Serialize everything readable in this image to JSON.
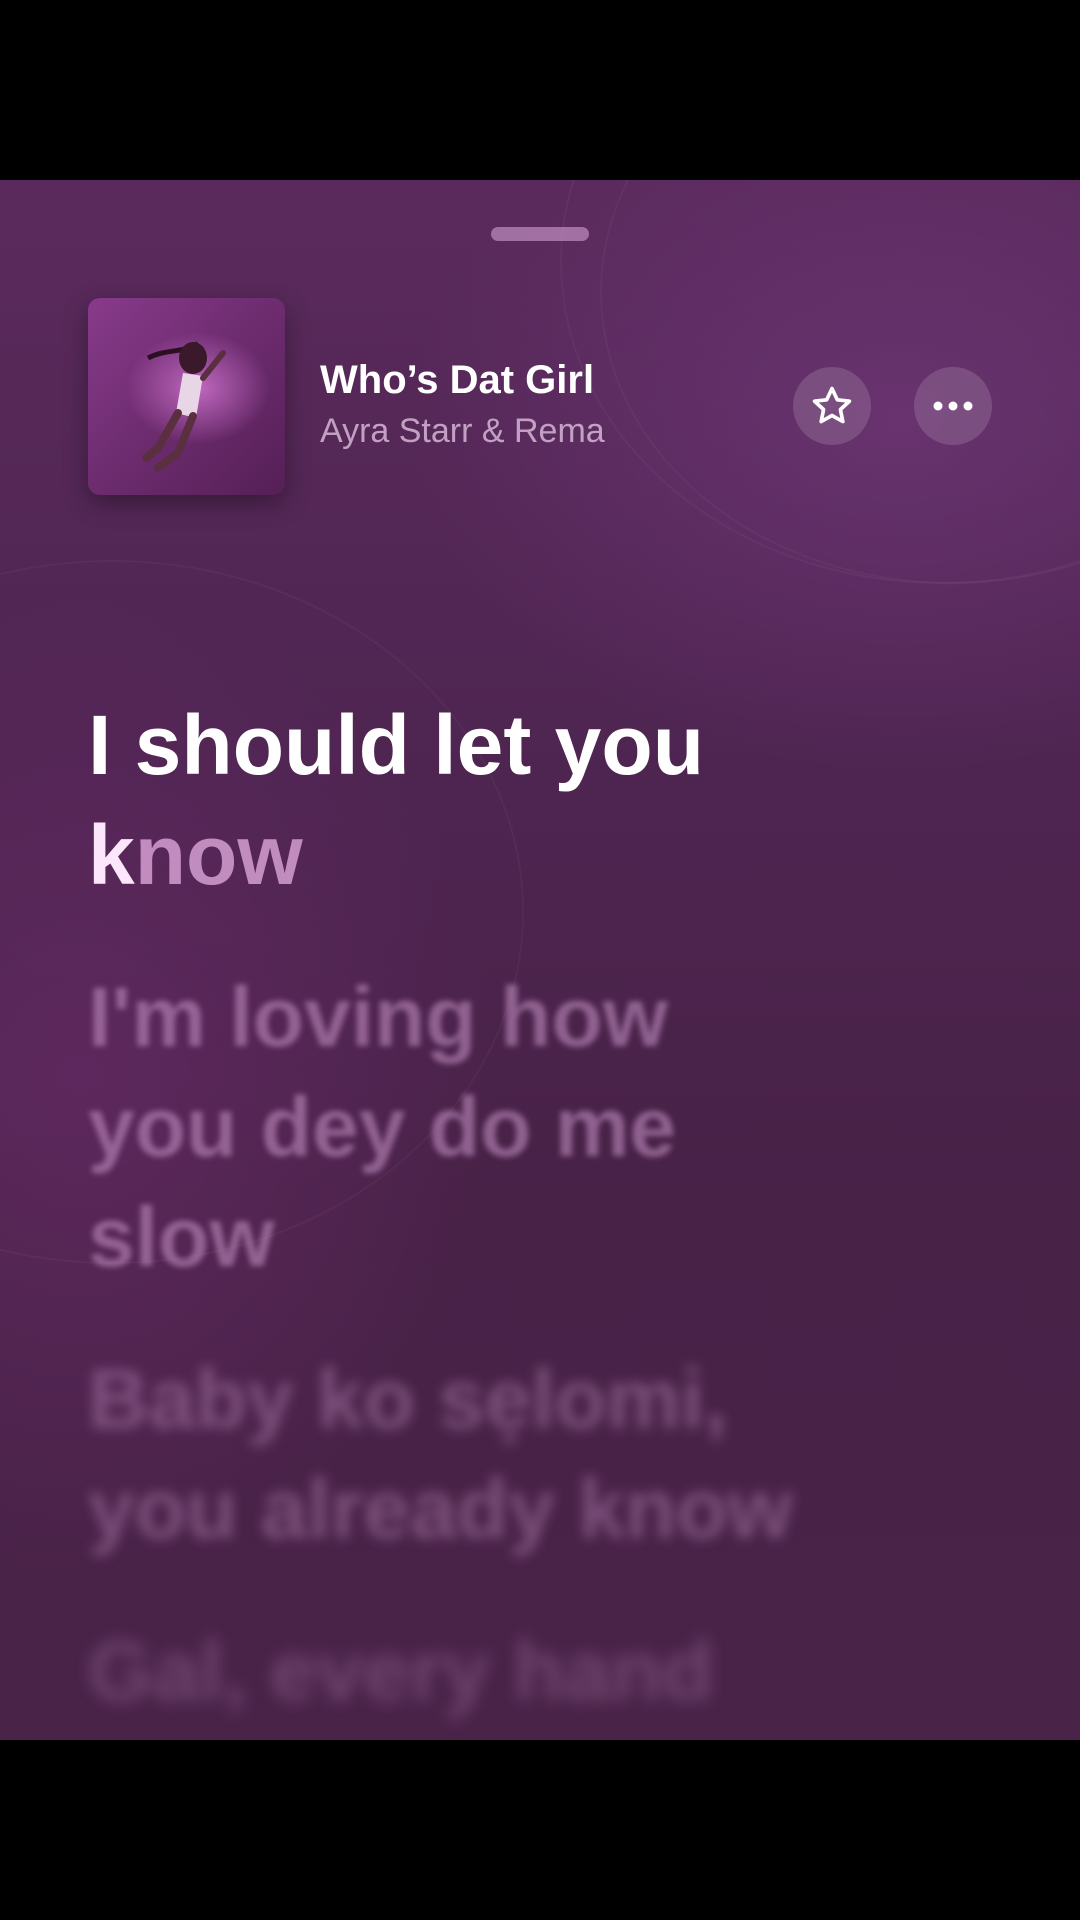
{
  "now_playing": {
    "title": "Who’s Dat Girl",
    "artist": "Ayra Starr & Rema"
  },
  "buttons": {
    "favorite_icon": "star-icon",
    "more_icon": "ellipsis-icon"
  },
  "lyrics": {
    "active_line": {
      "sung": "I should let you",
      "current_word_sung": "k",
      "current_word_pending": "now"
    },
    "upcoming": [
      "I'm loving how you dey do me slow",
      "Baby ko sẹlomi, you already know",
      "Gal, every hand"
    ]
  },
  "colors": {
    "background": "#4f2552",
    "active_lyric": "#ffffff",
    "artist_text": "#c9a6c9"
  }
}
